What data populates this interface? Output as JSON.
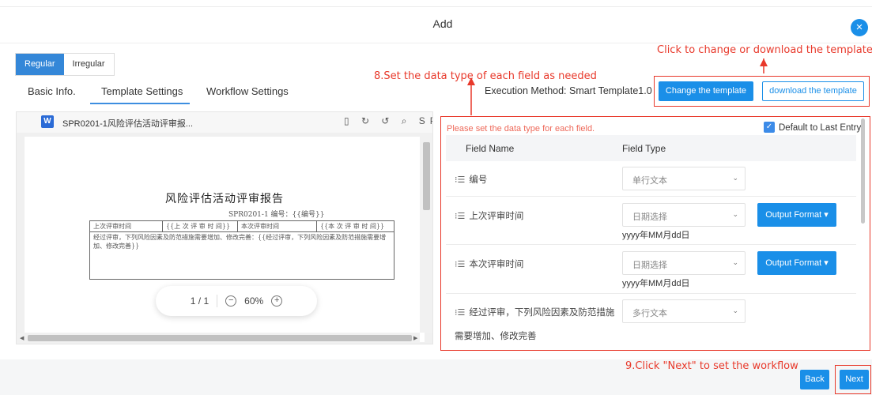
{
  "dialog": {
    "title": "Add",
    "close_icon": "×"
  },
  "mode": {
    "regular": "Regular",
    "irregular": "Irregular"
  },
  "tabs": [
    "Basic Info.",
    "Template Settings",
    "Workflow Settings"
  ],
  "annotations": {
    "set_data_type": "8.Set the data type of each field as needed",
    "change_template": "Click to change or download the template",
    "next": "9.Click \"Next\" to set the workflow"
  },
  "execution_method": "Execution Method: Smart Template1.0",
  "buttons": {
    "change_template": "Change the template",
    "download_template": "download the template",
    "output_format": "Output Format ▾",
    "back": "Back",
    "next": "Next"
  },
  "preview": {
    "file_name": "SPR0201-1风险评估活动评审报...",
    "file_icon": "W",
    "tools": "▯ ↻ ↺ ⌕ SP",
    "doc_title": "风险评估活动评审报告",
    "doc_code": "SPR0201-1   编号：{{编号}}",
    "table": {
      "r1c1": "上次评审时间",
      "r1c2": "{{上 次 评 审 时 间}}",
      "r1c3": "本次评审时间",
      "r1c4": "{{本 次 评 审 时 间}}",
      "r2": "经过评审，下列风险因素及防范措施需要增加、修改完善：{{经过评审，下列风险因素及防范措施需要增加、修改完善}}"
    },
    "zoom": {
      "page": "1 / 1",
      "minus": "−",
      "level": "60%",
      "plus": "+"
    }
  },
  "fields_panel": {
    "hint": "Please set the data type for each field.",
    "default_last_entry": "Default to Last Entry",
    "col_name": "Field Name",
    "col_type": "Field Type",
    "rows": [
      {
        "name": "编号",
        "type": "单行文本"
      },
      {
        "name": "上次评审时间",
        "type": "日期选择",
        "format": "yyyy年MM月dd日"
      },
      {
        "name": "本次评审时间",
        "type": "日期选择",
        "format": "yyyy年MM月dd日"
      },
      {
        "name": "经过评审，下列风险因素及防范措施",
        "name_cont": "需要增加、修改完善",
        "type": "多行文本"
      }
    ]
  }
}
